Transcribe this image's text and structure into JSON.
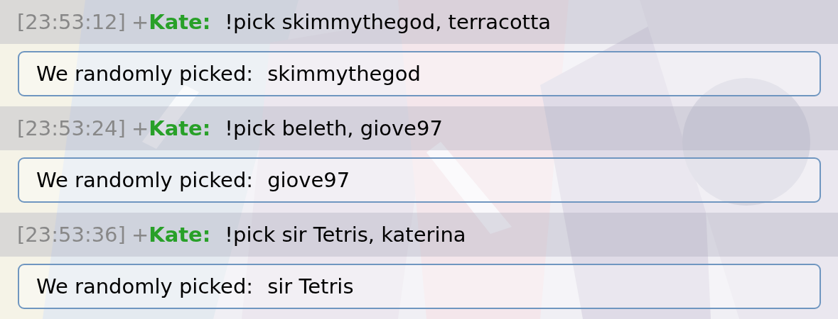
{
  "entries": [
    {
      "timestamp": "[23:53:12]",
      "rank": "+",
      "user": "Kate:",
      "message": "!pick skimmythegod, terracotta",
      "reply": {
        "label": "We randomly picked:",
        "value": "skimmythegod"
      }
    },
    {
      "timestamp": "[23:53:24]",
      "rank": "+",
      "user": "Kate:",
      "message": "!pick beleth, giove97",
      "reply": {
        "label": "We randomly picked:",
        "value": "giove97"
      }
    },
    {
      "timestamp": "[23:53:36]",
      "rank": "+",
      "user": "Kate:",
      "message": "!pick sir Tetris, katerina",
      "reply": {
        "label": "We randomly picked:",
        "value": "sir Tetris"
      }
    }
  ]
}
